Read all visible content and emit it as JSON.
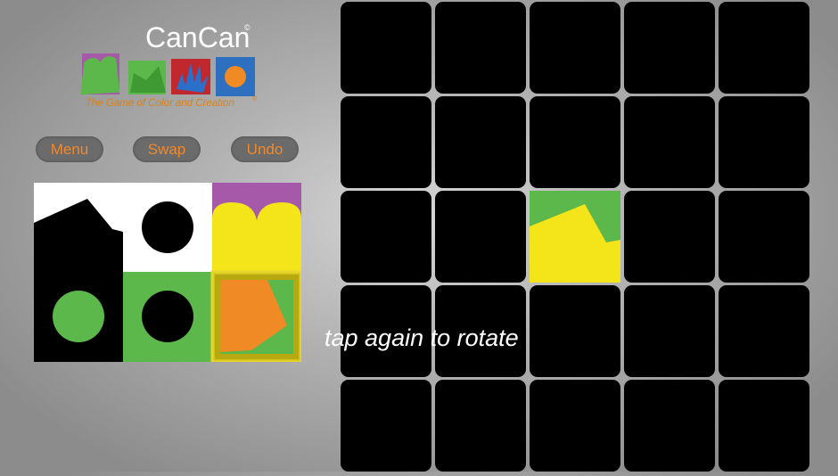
{
  "logo": {
    "title": "CanCan",
    "title_mark": "©",
    "tagline": "The Game of Color and Creation",
    "tagline_mark": "®"
  },
  "buttons": {
    "menu": "Menu",
    "swap": "Swap",
    "undo": "Undo"
  },
  "hint": "tap again to rotate",
  "board": {
    "rows": 5,
    "cols": 5,
    "placed_tile": {
      "row": 2,
      "col": 2,
      "colors": [
        "#5cb84a",
        "#f4e41a"
      ]
    }
  },
  "hand": {
    "selected_tile": "hand-tile-orange",
    "colors": {
      "black": "#000000",
      "white": "#ffffff",
      "green": "#5cb84a",
      "yellow": "#f4e41a",
      "purple": "#a559a8",
      "orange": "#f08a24",
      "gold": "#d4c21a"
    }
  },
  "colors": {
    "button_bg": "#6b6b6b",
    "button_text": "#f0892d",
    "cell": "#000000"
  }
}
